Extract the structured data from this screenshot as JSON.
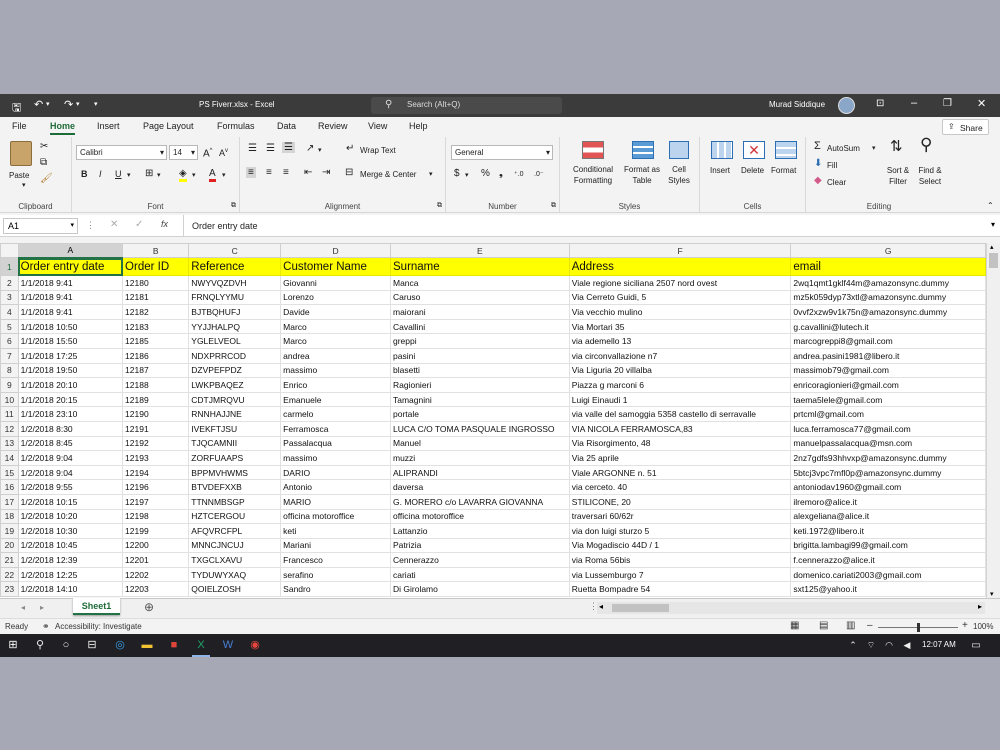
{
  "titlebar": {
    "doc_title": "PS Fiverr.xlsx  -  Excel",
    "search_placeholder": "Search (Alt+Q)",
    "user_name": "Murad Siddique"
  },
  "tabs": [
    "File",
    "Home",
    "Insert",
    "Page Layout",
    "Formulas",
    "Data",
    "Review",
    "View",
    "Help"
  ],
  "share_label": "Share",
  "ribbon": {
    "clipboard": {
      "paste": "Paste",
      "label": "Clipboard"
    },
    "font": {
      "name": "Calibri",
      "size": "14",
      "label": "Font"
    },
    "alignment": {
      "wrap": "Wrap Text",
      "merge": "Merge & Center",
      "label": "Alignment"
    },
    "number": {
      "format": "General",
      "label": "Number"
    },
    "styles": {
      "conditional": "Conditional Formatting",
      "format_table": "Format as Table",
      "cell_styles": "Cell Styles",
      "label": "Styles"
    },
    "cells": {
      "insert": "Insert",
      "delete": "Delete",
      "format": "Format",
      "label": "Cells"
    },
    "editing": {
      "autosum": "AutoSum",
      "fill": "Fill",
      "clear": "Clear",
      "sort": "Sort & Filter",
      "find": "Find & Select",
      "label": "Editing"
    }
  },
  "formula_bar": {
    "name_box": "A1",
    "fx": "fx",
    "content": "Order entry date"
  },
  "columns": [
    "A",
    "B",
    "C",
    "D",
    "E",
    "F",
    "G"
  ],
  "headers": [
    "Order entry date",
    "Order ID",
    "Reference",
    "Customer Name",
    "Surname",
    "Address",
    "email"
  ],
  "rows": [
    [
      "1/1/2018 9:41",
      "12180",
      "NWYVQZDVH",
      "Giovanni",
      "Manca",
      "Viale regione siciliana 2507 nord ovest",
      "2wq1qmt1gklf44m@amazonsync.dummy"
    ],
    [
      "1/1/2018 9:41",
      "12181",
      "FRNQLYYMU",
      "Lorenzo",
      "Caruso",
      "Via Cerreto Guidi, 5",
      "mz5k059dyp73xtl@amazonsync.dummy"
    ],
    [
      "1/1/2018 9:41",
      "12182",
      "BJTBQHUFJ",
      "Davide",
      "maiorani",
      "Via vecchio mulino",
      "0vvf2xzw9v1k75n@amazonsync.dummy"
    ],
    [
      "1/1/2018 10:50",
      "12183",
      "YYJJHALPQ",
      "Marco",
      "Cavallini",
      "Via Mortari 35",
      "g.cavallini@lutech.it"
    ],
    [
      "1/1/2018 15:50",
      "12185",
      "YGLELVEOL",
      "Marco",
      "greppi",
      "via ademello 13",
      "marcogreppi8@gmail.com"
    ],
    [
      "1/1/2018 17:25",
      "12186",
      "NDXPRRCOD",
      "andrea",
      "pasini",
      "via circonvallazione n7",
      "andrea.pasini1981@libero.it"
    ],
    [
      "1/1/2018 19:50",
      "12187",
      "DZVPEFPDZ",
      "massimo",
      "blasetti",
      "Via Liguria 20 villalba",
      "massimob79@gmail.com"
    ],
    [
      "1/1/2018 20:10",
      "12188",
      "LWKPBAQEZ",
      "Enrico",
      "Ragionieri",
      "Piazza g marconi 6",
      "enricoragionieri@gmail.com"
    ],
    [
      "1/1/2018 20:15",
      "12189",
      "CDTJMRQVU",
      "Emanuele",
      "Tamagnini",
      "Luigi Einaudi 1",
      "taema5lele@gmail.com"
    ],
    [
      "1/1/2018 23:10",
      "12190",
      "RNNHAJJNE",
      "carmelo",
      "portale",
      "via valle del samoggia 5358 castello di serravalle",
      "prtcml@gmail.com"
    ],
    [
      "1/2/2018 8:30",
      "12191",
      "IVEKFTJSU",
      "Ferramosca",
      "LUCA C/O TOMA PASQUALE INGROSSO",
      "VIA NICOLA FERRAMOSCA,83",
      "luca.ferramosca77@gmail.com"
    ],
    [
      "1/2/2018 8:45",
      "12192",
      "TJQCAMNII",
      "Passalacqua",
      "Manuel",
      "Via Risorgimento, 48",
      "manuelpassalacqua@msn.com"
    ],
    [
      "1/2/2018 9:04",
      "12193",
      "ZORFUAAPS",
      "massimo",
      "muzzi",
      "Via 25 aprile",
      "2nz7gdfs93hhvxp@amazonsync.dummy"
    ],
    [
      "1/2/2018 9:04",
      "12194",
      "BPPMVHWMS",
      "DARIO",
      "ALIPRANDI",
      "Viale ARGONNE n. 51",
      "5btcj3vpc7mfl0p@amazonsync.dummy"
    ],
    [
      "1/2/2018 9:55",
      "12196",
      "BTVDEFXXB",
      "Antonio",
      "daversa",
      "via cerceto. 40",
      "antoniodav1960@gmail.com"
    ],
    [
      "1/2/2018 10:15",
      "12197",
      "TTNNMBSGP",
      "MARIO",
      "G. MORERO c/o LAVARRA GIOVANNA",
      "STILICONE, 20",
      "ilremoro@alice.it"
    ],
    [
      "1/2/2018 10:20",
      "12198",
      "HZTCERGOU",
      "officina motoroffice",
      "officina motoroffice",
      "traversari 60/62r",
      "alexgeliana@alice.it"
    ],
    [
      "1/2/2018 10:30",
      "12199",
      "AFQVRCFPL",
      "keti",
      "Lattanzio",
      "via don luigi sturzo 5",
      "keti.1972@libero.it"
    ],
    [
      "1/2/2018 10:45",
      "12200",
      "MNNCJNCUJ",
      "Mariani",
      "Patrizia",
      "Via Mogadiscio 44D / 1",
      "brigitta.lambagi99@gmail.com"
    ],
    [
      "1/2/2018 12:39",
      "12201",
      "TXGCLXAVU",
      "Francesco",
      "Cennerazzo",
      " via Roma 56bis",
      "f.cennerazzo@alice.it"
    ],
    [
      "1/2/2018 12:25",
      "12202",
      "TYDUWYXAQ",
      "serafino",
      "cariati",
      "via Lussemburgo 7",
      "domenico.cariati2003@gmail.com"
    ],
    [
      "1/2/2018 14:10",
      "12203",
      "QOIELZOSH",
      "Sandro",
      "Di Girolamo",
      "Ruetta Bompadre 54",
      "sxt125@yahoo.it"
    ]
  ],
  "sheet_tab": "Sheet1",
  "status": {
    "ready": "Ready",
    "accessibility": "Accessibility: Investigate",
    "zoom": "100%"
  },
  "taskbar": {
    "time": "12:07 AM"
  }
}
